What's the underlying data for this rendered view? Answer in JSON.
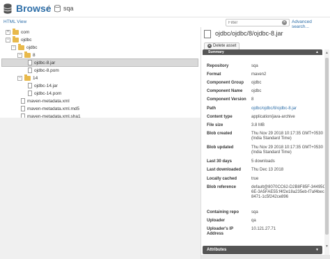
{
  "header": {
    "title": "Browse",
    "separator": "/",
    "repo_name": "sqa"
  },
  "subbar": {
    "html_view_label": "HTML View",
    "filter_placeholder": "Filter",
    "advanced_search_label": "Advanced search..."
  },
  "tree": {
    "nodes": [
      {
        "label": "com",
        "toggle": "+",
        "kind": "folder"
      },
      {
        "label": "ojdbc",
        "toggle": "−",
        "kind": "folder"
      },
      {
        "label": "ojdbc",
        "toggle": "−",
        "kind": "folder"
      },
      {
        "label": "8",
        "toggle": "−",
        "kind": "folder"
      },
      {
        "label": "ojdbc-8.jar",
        "toggle": "",
        "kind": "file",
        "selected": true
      },
      {
        "label": "ojdbc-8.pom",
        "toggle": "",
        "kind": "file"
      },
      {
        "label": "14",
        "toggle": "−",
        "kind": "folder"
      },
      {
        "label": "ojdbc-14.jar",
        "toggle": "",
        "kind": "file"
      },
      {
        "label": "ojdbc-14.pom",
        "toggle": "",
        "kind": "file"
      },
      {
        "label": "maven-metadata.xml",
        "toggle": "",
        "kind": "file"
      },
      {
        "label": "maven-metadata.xml.md5",
        "toggle": "",
        "kind": "file"
      },
      {
        "label": "maven-metadata.xml.sha1",
        "toggle": "",
        "kind": "file"
      }
    ]
  },
  "details": {
    "asset_path": "ojdbc/ojdbc/8/ojdbc-8.jar",
    "delete_label": "Delete asset",
    "summary_label": "Summary",
    "attributes_label": "Attributes",
    "rows": [
      {
        "key": "Repository",
        "value": "sqa"
      },
      {
        "key": "Format",
        "value": "maven2"
      },
      {
        "key": "Component Group",
        "value": "ojdbc"
      },
      {
        "key": "Component Name",
        "value": "ojdbc"
      },
      {
        "key": "Component Version",
        "value": "8"
      },
      {
        "key": "Path",
        "value": "ojdbc/ojdbc/8/ojdbc-8.jar",
        "link": true
      },
      {
        "key": "Content type",
        "value": "application/java-archive"
      },
      {
        "key": "File size",
        "value": "3.8 MB"
      },
      {
        "key": "Blob created",
        "value": "Thu Nov 29 2018 10:17:35 GMT+0530 (India Standard Time)"
      },
      {
        "key": "Blob updated",
        "value": "Thu Nov 29 2018 10:17:35 GMT+0530 (India Standard Time)"
      },
      {
        "key": "Last 30 days",
        "value": "5 downloads"
      },
      {
        "key": "Last downloaded",
        "value": "Thu Dec 13 2018"
      },
      {
        "key": "Locally cached",
        "value": "true"
      },
      {
        "key": "Blob reference",
        "value": "default@8070CC62-D2B8F85F-34495C6E-3A5FAE55:f4f2e18a235eb-f7af4bec-8471-1c5f242ce896"
      },
      {
        "key": "Containing repo",
        "value": "sqa"
      },
      {
        "key": "Uploader",
        "value": "qa"
      },
      {
        "key": "Uploader's IP Address",
        "value": "10.121.27.71"
      }
    ]
  },
  "colors": {
    "accent": "#2d6ea8",
    "folder": "#e8b94b",
    "panel_bar": "#555555"
  }
}
